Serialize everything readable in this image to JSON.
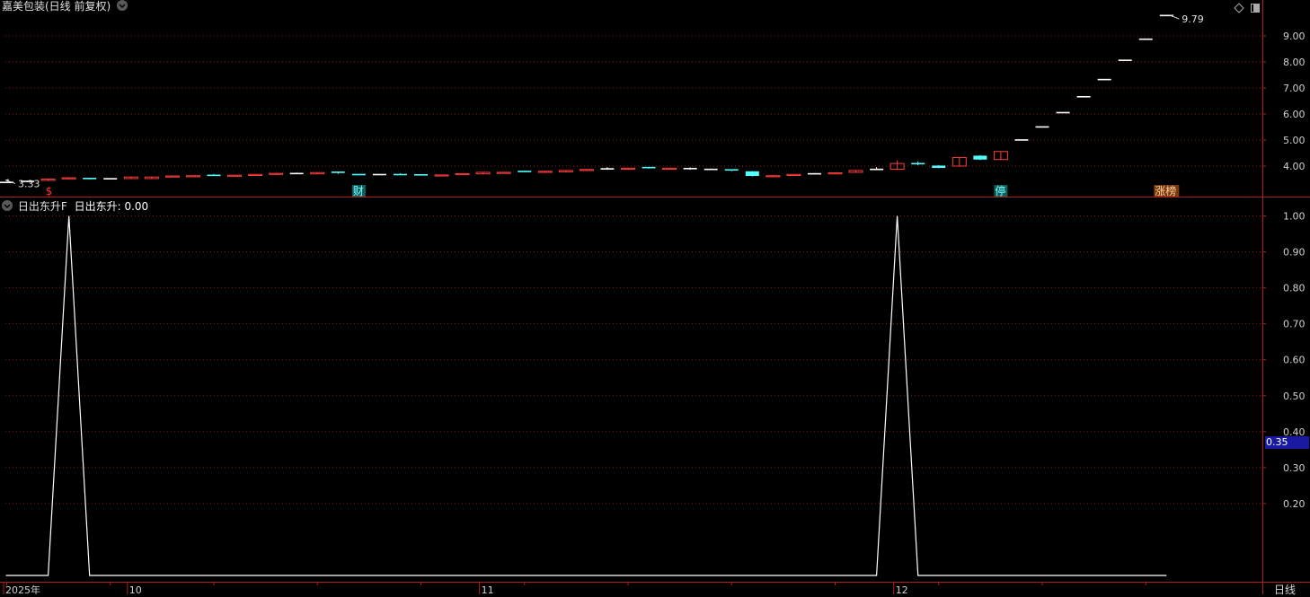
{
  "colors": {
    "up": "#ff3c3c",
    "down": "#54ffff",
    "flat": "#ffffff",
    "grid": "#8b1a1a",
    "frame": "#b01e1e",
    "axis_text": "#d0d0d0",
    "indicator_line": "#ffffff",
    "marker_value_bg": "#1a1aa0"
  },
  "main_panel": {
    "title": "嘉美包装(日线 前复权)",
    "dropdown_icon": "chevron-down-icon",
    "top_right_icons": [
      "diamond-icon",
      "restore-icon"
    ],
    "high_label": "9.79",
    "low_label": "3.33",
    "event_markers": [
      {
        "label": "$",
        "bar": 2,
        "style": "red-text"
      },
      {
        "label": "财",
        "bar": 17,
        "style": "teal-box"
      },
      {
        "label": "停",
        "bar": 48,
        "style": "teal-box"
      },
      {
        "label": "涨榜",
        "bar": 56,
        "style": "orange-box"
      }
    ]
  },
  "indicator_panel": {
    "name": "日出东升F",
    "label": "日出东升",
    "value": "0.00",
    "marker_value": "0.35",
    "dropdown_icon": "chevron-down-icon"
  },
  "x_axis": {
    "labels": [
      {
        "text": "2025年",
        "bar": 0
      },
      {
        "text": "10",
        "bar": 6
      },
      {
        "text": "11",
        "bar": 23
      },
      {
        "text": "12",
        "bar": 43
      }
    ],
    "period_label": "日线"
  },
  "chart_data": [
    {
      "type": "candlestick",
      "title": "嘉美包装(日线 前复权)",
      "y_ticks": [
        4.0,
        5.0,
        6.0,
        7.0,
        8.0,
        9.0
      ],
      "ylim": [
        3.0,
        10.3
      ],
      "grid": true,
      "candles": [
        {
          "o": 3.38,
          "c": 3.38,
          "h": 3.4,
          "l": 3.35,
          "d": "flat"
        },
        {
          "o": 3.4,
          "c": 3.42,
          "h": 3.43,
          "l": 3.39,
          "d": "flat"
        },
        {
          "o": 3.45,
          "c": 3.5,
          "h": 3.51,
          "l": 3.44,
          "d": "up"
        },
        {
          "o": 3.55,
          "c": 3.51,
          "h": 3.57,
          "l": 3.5,
          "d": "up"
        },
        {
          "o": 3.53,
          "c": 3.5,
          "h": 3.54,
          "l": 3.49,
          "d": "down"
        },
        {
          "o": 3.52,
          "c": 3.5,
          "h": 3.53,
          "l": 3.49,
          "d": "flat"
        },
        {
          "o": 3.52,
          "c": 3.58,
          "h": 3.59,
          "l": 3.51,
          "d": "up"
        },
        {
          "o": 3.52,
          "c": 3.58,
          "h": 3.59,
          "l": 3.51,
          "d": "up"
        },
        {
          "o": 3.6,
          "c": 3.62,
          "h": 3.63,
          "l": 3.59,
          "d": "up"
        },
        {
          "o": 3.62,
          "c": 3.63,
          "h": 3.64,
          "l": 3.61,
          "d": "up"
        },
        {
          "o": 3.65,
          "c": 3.63,
          "h": 3.7,
          "l": 3.62,
          "d": "down"
        },
        {
          "o": 3.64,
          "c": 3.65,
          "h": 3.66,
          "l": 3.63,
          "d": "up"
        },
        {
          "o": 3.67,
          "c": 3.68,
          "h": 3.69,
          "l": 3.66,
          "d": "up"
        },
        {
          "o": 3.68,
          "c": 3.72,
          "h": 3.73,
          "l": 3.67,
          "d": "up"
        },
        {
          "o": 3.72,
          "c": 3.71,
          "h": 3.75,
          "l": 3.7,
          "d": "flat"
        },
        {
          "o": 3.7,
          "c": 3.75,
          "h": 3.76,
          "l": 3.69,
          "d": "up"
        },
        {
          "o": 3.77,
          "c": 3.71,
          "h": 3.78,
          "l": 3.7,
          "d": "down"
        },
        {
          "o": 3.68,
          "c": 3.67,
          "h": 3.69,
          "l": 3.66,
          "d": "down"
        },
        {
          "o": 3.67,
          "c": 3.68,
          "h": 3.69,
          "l": 3.66,
          "d": "flat"
        },
        {
          "o": 3.68,
          "c": 3.67,
          "h": 3.72,
          "l": 3.66,
          "d": "down"
        },
        {
          "o": 3.67,
          "c": 3.66,
          "h": 3.68,
          "l": 3.64,
          "d": "down"
        },
        {
          "o": 3.64,
          "c": 3.66,
          "h": 3.67,
          "l": 3.63,
          "d": "up"
        },
        {
          "o": 3.68,
          "c": 3.71,
          "h": 3.72,
          "l": 3.67,
          "d": "up"
        },
        {
          "o": 3.7,
          "c": 3.76,
          "h": 3.77,
          "l": 3.69,
          "d": "up"
        },
        {
          "o": 3.75,
          "c": 3.76,
          "h": 3.78,
          "l": 3.74,
          "d": "up"
        },
        {
          "o": 3.8,
          "c": 3.79,
          "h": 3.82,
          "l": 3.78,
          "d": "down"
        },
        {
          "o": 3.78,
          "c": 3.8,
          "h": 3.81,
          "l": 3.77,
          "d": "up"
        },
        {
          "o": 3.78,
          "c": 3.83,
          "h": 3.84,
          "l": 3.77,
          "d": "up"
        },
        {
          "o": 3.84,
          "c": 3.87,
          "h": 3.88,
          "l": 3.83,
          "d": "up"
        },
        {
          "o": 3.88,
          "c": 3.9,
          "h": 3.96,
          "l": 3.86,
          "d": "flat"
        },
        {
          "o": 3.88,
          "c": 3.92,
          "h": 3.93,
          "l": 3.87,
          "d": "up"
        },
        {
          "o": 3.95,
          "c": 3.91,
          "h": 3.97,
          "l": 3.9,
          "d": "down"
        },
        {
          "o": 3.9,
          "c": 3.92,
          "h": 3.93,
          "l": 3.89,
          "d": "up"
        },
        {
          "o": 3.91,
          "c": 3.88,
          "h": 3.95,
          "l": 3.86,
          "d": "flat"
        },
        {
          "o": 3.88,
          "c": 3.87,
          "h": 3.9,
          "l": 3.85,
          "d": "flat"
        },
        {
          "o": 3.86,
          "c": 3.82,
          "h": 3.87,
          "l": 3.8,
          "d": "down"
        },
        {
          "o": 3.8,
          "c": 3.62,
          "h": 3.81,
          "l": 3.6,
          "d": "down"
        },
        {
          "o": 3.62,
          "c": 3.63,
          "h": 3.65,
          "l": 3.61,
          "d": "up"
        },
        {
          "o": 3.65,
          "c": 3.68,
          "h": 3.69,
          "l": 3.64,
          "d": "up"
        },
        {
          "o": 3.7,
          "c": 3.71,
          "h": 3.73,
          "l": 3.69,
          "d": "flat"
        },
        {
          "o": 3.7,
          "c": 3.74,
          "h": 3.75,
          "l": 3.69,
          "d": "up"
        },
        {
          "o": 3.76,
          "c": 3.83,
          "h": 3.84,
          "l": 3.75,
          "d": "up"
        },
        {
          "o": 3.86,
          "c": 3.88,
          "h": 3.96,
          "l": 3.84,
          "d": "flat"
        },
        {
          "o": 3.88,
          "c": 4.1,
          "h": 4.22,
          "l": 3.87,
          "d": "up"
        },
        {
          "o": 4.1,
          "c": 4.05,
          "h": 4.18,
          "l": 4.03,
          "d": "down"
        },
        {
          "o": 4.02,
          "c": 3.93,
          "h": 4.04,
          "l": 3.92,
          "d": "down"
        },
        {
          "o": 4.0,
          "c": 4.33,
          "h": 4.34,
          "l": 3.99,
          "d": "up"
        },
        {
          "o": 4.4,
          "c": 4.25,
          "h": 4.42,
          "l": 4.23,
          "d": "down"
        },
        {
          "o": 4.25,
          "c": 4.56,
          "h": 4.57,
          "l": 4.24,
          "d": "up"
        },
        {
          "o": 5.01,
          "c": 5.01,
          "h": 5.01,
          "l": 5.01,
          "d": "flat"
        },
        {
          "o": 5.51,
          "c": 5.51,
          "h": 5.51,
          "l": 5.51,
          "d": "flat"
        },
        {
          "o": 6.06,
          "c": 6.06,
          "h": 6.06,
          "l": 6.06,
          "d": "flat"
        },
        {
          "o": 6.67,
          "c": 6.67,
          "h": 6.67,
          "l": 6.67,
          "d": "flat"
        },
        {
          "o": 7.33,
          "c": 7.33,
          "h": 7.33,
          "l": 7.33,
          "d": "flat"
        },
        {
          "o": 8.07,
          "c": 8.07,
          "h": 8.07,
          "l": 8.07,
          "d": "flat"
        },
        {
          "o": 8.88,
          "c": 8.88,
          "h": 8.88,
          "l": 8.88,
          "d": "flat"
        },
        {
          "o": 9.79,
          "c": 9.79,
          "h": 9.79,
          "l": 9.79,
          "d": "flat"
        }
      ]
    },
    {
      "type": "line",
      "title": "日出东升F",
      "series": [
        {
          "name": "日出东升",
          "values": [
            0,
            0,
            0,
            1,
            0,
            0,
            0,
            0,
            0,
            0,
            0,
            0,
            0,
            0,
            0,
            0,
            0,
            0,
            0,
            0,
            0,
            0,
            0,
            0,
            0,
            0,
            0,
            0,
            0,
            0,
            0,
            0,
            0,
            0,
            0,
            0,
            0,
            0,
            0,
            0,
            0,
            0,
            0,
            1,
            0,
            0,
            0,
            0,
            0,
            0,
            0,
            0,
            0,
            0,
            0,
            0,
            0
          ]
        }
      ],
      "y_ticks": [
        0.2,
        0.3,
        0.4,
        0.5,
        0.6,
        0.7,
        0.8,
        0.9,
        1.0
      ],
      "ylim": [
        0.0,
        1.0
      ],
      "grid": true
    }
  ]
}
